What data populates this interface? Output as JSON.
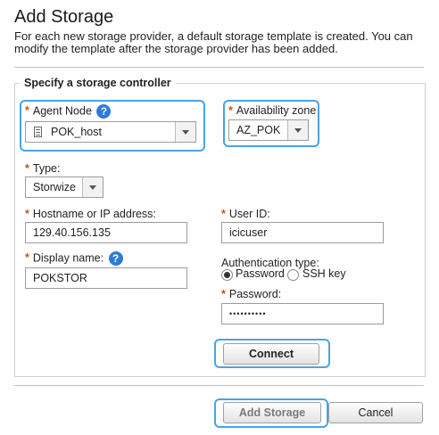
{
  "header": {
    "title": "Add Storage",
    "description": "For each new storage provider, a default storage template is created. You can modify the template after the storage provider has been added."
  },
  "section": {
    "legend": "Specify a storage controller"
  },
  "required_mark": "*",
  "agent_node": {
    "label": "Agent Node",
    "value": "POK_host",
    "icon": "server-icon",
    "help_icon": "question-icon"
  },
  "availability_zone": {
    "label": "Availability zone",
    "value": "AZ_POK"
  },
  "type": {
    "label": "Type:",
    "value": "Storwize"
  },
  "hostname": {
    "label": "Hostname or IP address:",
    "value": "129.40.156.135"
  },
  "display_name": {
    "label": "Display name:",
    "value": "POKSTOR",
    "help_icon": "question-icon"
  },
  "user_id": {
    "label": "User ID:",
    "value": "icicuser"
  },
  "authentication": {
    "label": "Authentication type:",
    "options": [
      {
        "label": "Password",
        "selected": true
      },
      {
        "label": "SSH key",
        "selected": false
      }
    ]
  },
  "password": {
    "label": "Password:",
    "value": "••••••••••"
  },
  "buttons": {
    "connect": "Connect",
    "add_storage": "Add Storage",
    "cancel": "Cancel"
  },
  "colors": {
    "highlight": "#4aa3e6",
    "required": "#c8501a",
    "help": "#2f7ad9"
  }
}
